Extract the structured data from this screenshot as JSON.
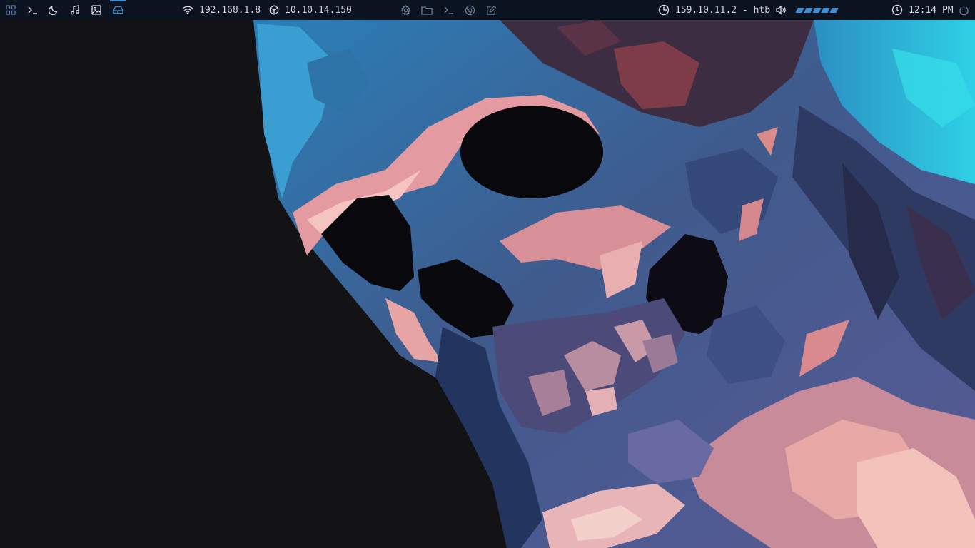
{
  "topbar": {
    "workspaces": [
      {
        "icon": "grid-icon",
        "active": false
      },
      {
        "icon": "terminal-icon",
        "active": false
      },
      {
        "icon": "moon-icon",
        "active": false
      },
      {
        "icon": "music-icon",
        "active": false
      },
      {
        "icon": "image-icon",
        "active": false
      },
      {
        "icon": "drive-icon",
        "active": true
      }
    ],
    "network": {
      "icon": "wifi-icon",
      "ip": "192.168.1.8"
    },
    "target": {
      "icon": "cube-icon",
      "ip": "10.10.14.150"
    },
    "launchers": [
      "gear-icon",
      "folder-icon",
      "terminal-icon",
      "chrome-icon",
      "edit-icon"
    ],
    "vpn": {
      "icon": "clock-half-icon",
      "text": "159.10.11.2 - htb"
    },
    "volume": {
      "icon": "speaker-icon",
      "level_percent": 100
    },
    "clock": {
      "icon": "clock-icon",
      "time": "12:14 PM"
    },
    "power": {
      "icon": "power-icon"
    },
    "accent_color": "#3c8fd6"
  },
  "wallpaper": {
    "icon": "skull-wallpaper",
    "background_color": "#131316"
  }
}
